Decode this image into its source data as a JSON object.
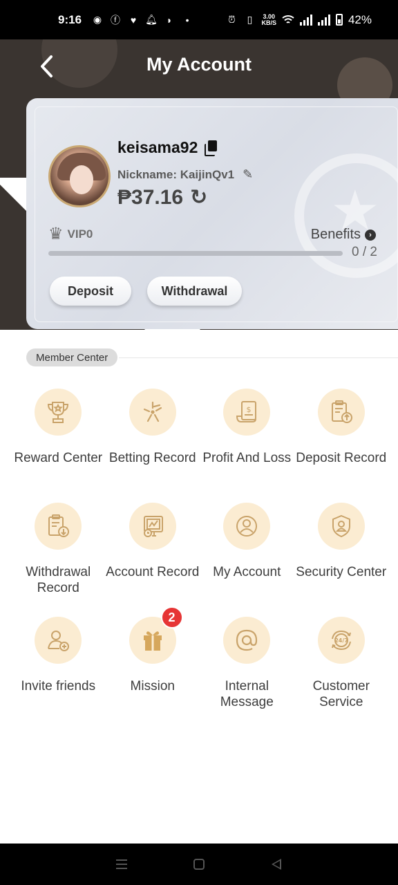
{
  "status_bar": {
    "time": "9:16",
    "net_speed_value": "3.00",
    "net_speed_unit": "KB/S",
    "battery": "42%",
    "left_icons": [
      "discord-icon",
      "facebook-icon",
      "heart-app-icon",
      "bell-icon",
      "shield-icon",
      "dot-icon"
    ],
    "right_icons": [
      "alarm-icon",
      "vibrate-icon",
      "wifi-icon",
      "signal-icon",
      "signal-icon",
      "battery-icon"
    ]
  },
  "header": {
    "title": "My Account",
    "back_icon": "chevron-left-icon"
  },
  "profile": {
    "username": "keisama92",
    "nickname": "Nickname: KaijinQv1",
    "balance": "₱37.16",
    "vip_level": "VIP0",
    "benefits_label": "Benefits",
    "progress_text": "0 / 2",
    "progress_fraction": 0,
    "deposit_label": "Deposit",
    "withdrawal_label": "Withdrawal"
  },
  "member_center": {
    "section_label": "Member Center",
    "items": [
      {
        "label": "Reward Center",
        "icon": "trophy-icon"
      },
      {
        "label": "Betting Record",
        "icon": "sparkle-icon"
      },
      {
        "label": "Profit And Loss",
        "icon": "dollar-document-icon"
      },
      {
        "label": "Deposit Record",
        "icon": "clipboard-upload-icon"
      },
      {
        "label": "Withdrawal Record",
        "icon": "clipboard-download-icon"
      },
      {
        "label": "Account Record",
        "icon": "account-record-icon"
      },
      {
        "label": "My Account",
        "icon": "user-circle-icon"
      },
      {
        "label": "Security Center",
        "icon": "shield-user-icon"
      },
      {
        "label": "Invite friends",
        "icon": "add-user-icon"
      },
      {
        "label": "Mission",
        "icon": "gift-icon",
        "badge": "2"
      },
      {
        "label": "Internal Message",
        "icon": "at-sign-icon"
      },
      {
        "label": "Customer Service",
        "icon": "support-24-7-icon"
      }
    ]
  },
  "colors": {
    "header_bg": "#3a3430",
    "icon_bg": "#fbecd2",
    "icon_stroke": "#c9a36a",
    "badge": "#e63535"
  }
}
